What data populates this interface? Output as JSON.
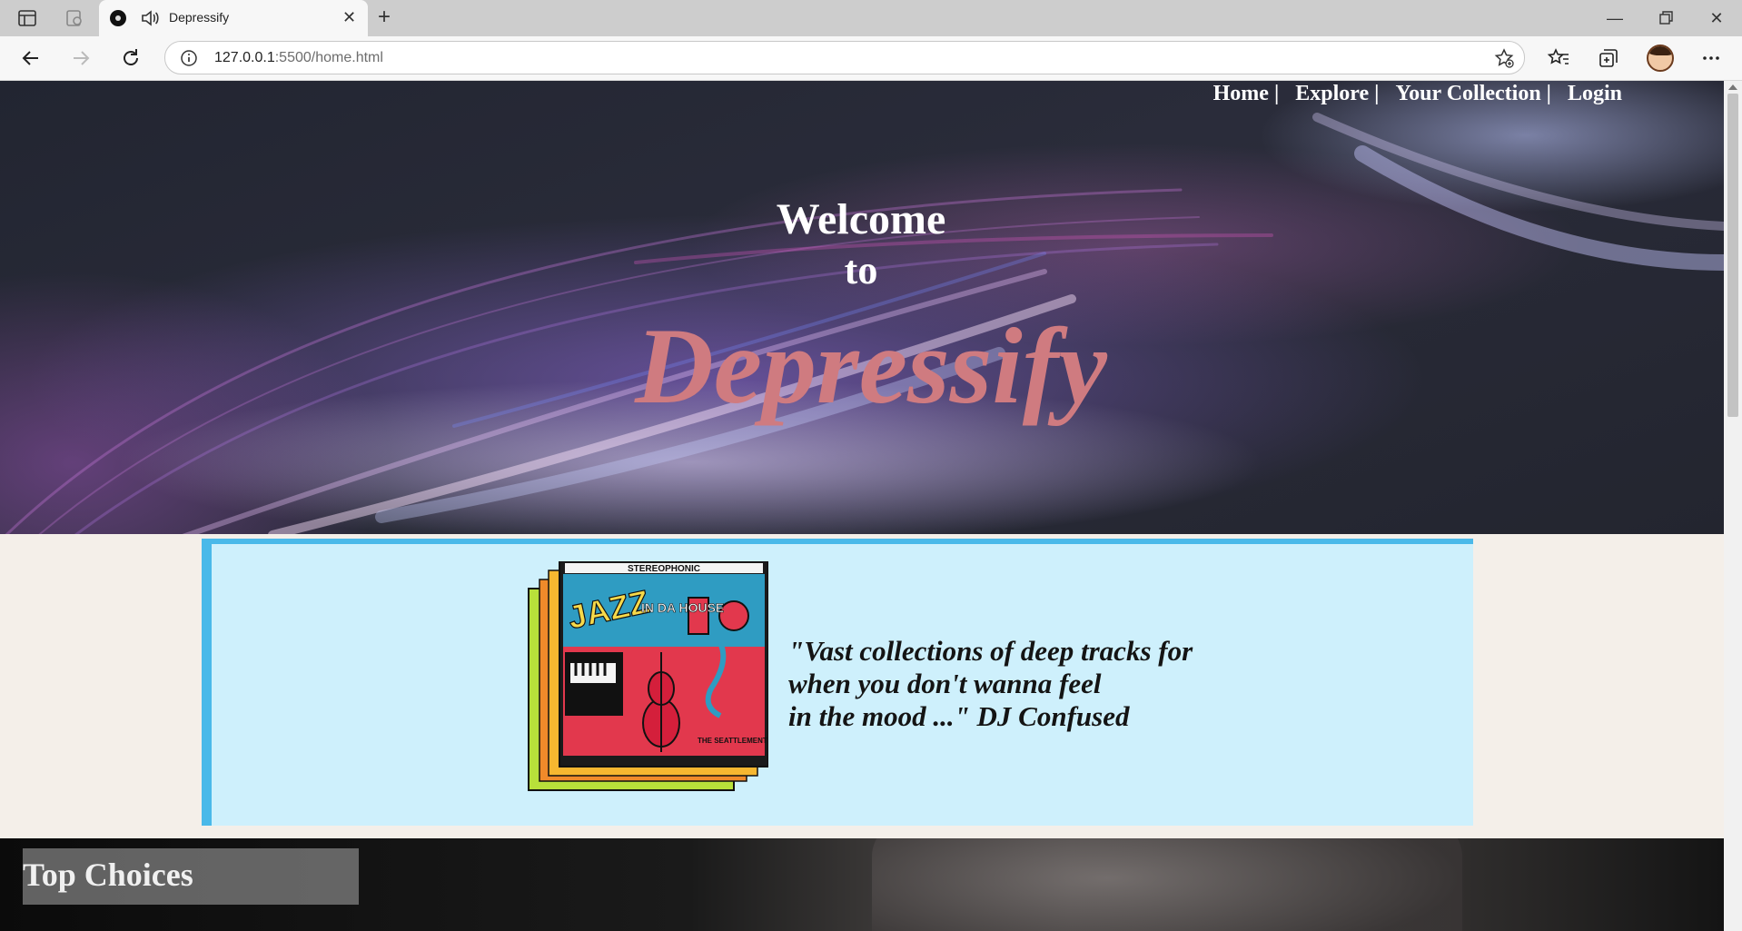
{
  "browser": {
    "tab_title": "Depressify",
    "url_host": "127.0.0.1",
    "url_rest": ":5500/home.html",
    "icons": [
      "tab-actions-icon",
      "workspaces-icon",
      "audio-playing-icon",
      "close-tab-icon",
      "new-tab-icon",
      "minimize-icon",
      "restore-icon",
      "close-window-icon",
      "back-icon",
      "forward-icon",
      "refresh-icon",
      "site-info-icon",
      "add-favorite-icon",
      "favorites-icon",
      "collections-icon",
      "profile-avatar",
      "more-icon"
    ]
  },
  "nav": {
    "items": [
      {
        "label": "Home"
      },
      {
        "label": "Explore"
      },
      {
        "label": "Your Collection"
      },
      {
        "label": "Login"
      }
    ],
    "separator": "|"
  },
  "hero": {
    "welcome_line1": "Welcome",
    "welcome_line2": "to",
    "brand": "Depressify"
  },
  "feature": {
    "album_top_text": "STEREOPHONIC",
    "album_title": "JAZZ",
    "album_subtitle": "IN DA HOUSE",
    "album_band": "THE SEATTLEMENT QUARTET",
    "quote_line1": "\"Vast collections of deep tracks for",
    "quote_line2": "when you don't wanna feel",
    "quote_line3": "in the mood ...\" DJ Confused"
  },
  "sections": {
    "top_choices_title": "Top Choices"
  },
  "colors": {
    "brand": "#cf7b80",
    "quote_bg": "#cef0fc",
    "quote_border": "#4ab9e9",
    "page_bg": "#f4efe9"
  }
}
